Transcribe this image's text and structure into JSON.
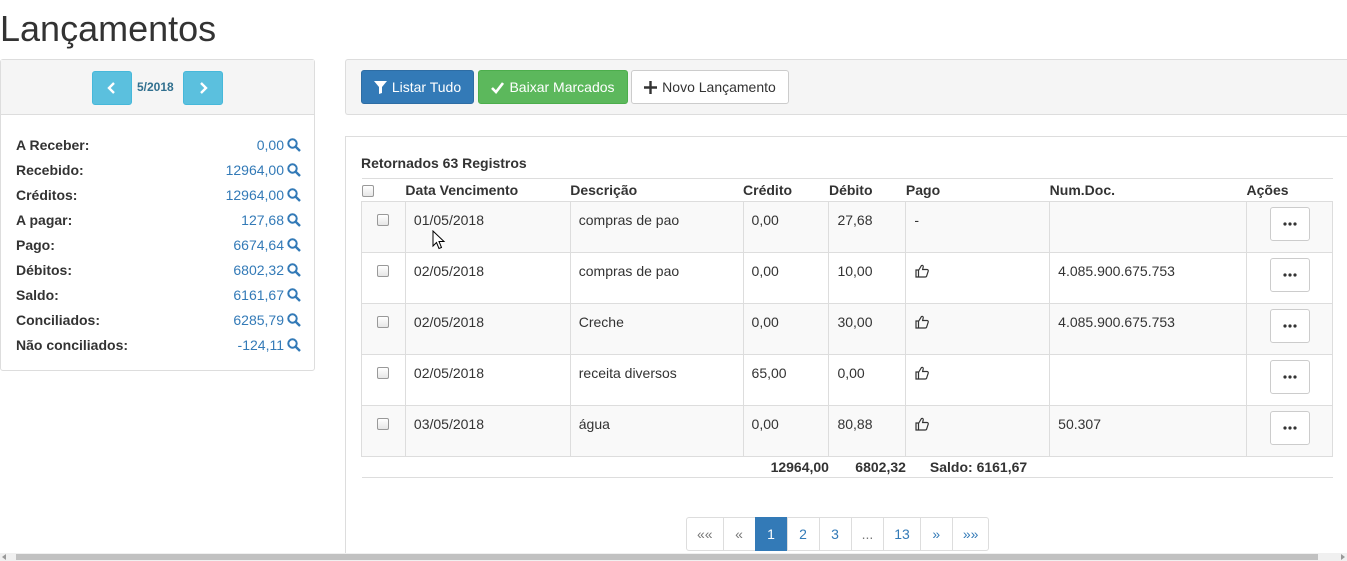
{
  "page": {
    "title": "Lançamentos"
  },
  "period": {
    "label": "5/2018"
  },
  "summary": [
    {
      "label": "A Receber:",
      "value": "0,00"
    },
    {
      "label": "Recebido:",
      "value": "12964,00"
    },
    {
      "label": "Créditos:",
      "value": "12964,00"
    },
    {
      "label": "A pagar:",
      "value": "127,68"
    },
    {
      "label": "Pago:",
      "value": "6674,64"
    },
    {
      "label": "Débitos:",
      "value": "6802,32"
    },
    {
      "label": "Saldo:",
      "value": "6161,67"
    },
    {
      "label": "Conciliados:",
      "value": "6285,79"
    },
    {
      "label": "Não conciliados:",
      "value": "-124,11"
    }
  ],
  "toolbar": {
    "listar_label": "Listar Tudo",
    "baixar_label": "Baixar Marcados",
    "novo_label": "Novo Lançamento"
  },
  "grid": {
    "count_text": "Retornados 63 Registros",
    "headers": {
      "data": "Data Vencimento",
      "descricao": "Descrição",
      "credito": "Crédito",
      "debito": "Débito",
      "pago": "Pago",
      "numdoc": "Num.Doc.",
      "acoes": "Ações"
    },
    "rows": [
      {
        "data": "01/05/2018",
        "descricao": "compras de pao",
        "credito": "0,00",
        "debito": "27,68",
        "pago": "-",
        "numdoc": ""
      },
      {
        "data": "02/05/2018",
        "descricao": "compras de pao",
        "credito": "0,00",
        "debito": "10,00",
        "pago": "",
        "numdoc": "4.085.900.675.753"
      },
      {
        "data": "02/05/2018",
        "descricao": "Creche",
        "credito": "0,00",
        "debito": "30,00",
        "pago": "",
        "numdoc": "4.085.900.675.753"
      },
      {
        "data": "02/05/2018",
        "descricao": "receita diversos",
        "credito": "65,00",
        "debito": "0,00",
        "pago": "",
        "numdoc": ""
      },
      {
        "data": "03/05/2018",
        "descricao": "água",
        "credito": "0,00",
        "debito": "80,88",
        "pago": "",
        "numdoc": "50.307"
      }
    ],
    "paid_icon": "thumbs-up-icon",
    "footer": {
      "credito": "12964,00",
      "debito": "6802,32",
      "saldo": "Saldo: 6161,67"
    }
  },
  "pagination": {
    "first": "««",
    "prev": "«",
    "pages": [
      "1",
      "2",
      "3",
      "...",
      "13"
    ],
    "active_page": "1",
    "next": "»",
    "last": "»»"
  },
  "colors": {
    "primary": "#337ab7",
    "info": "#5bc0de",
    "success": "#5cb85c"
  }
}
